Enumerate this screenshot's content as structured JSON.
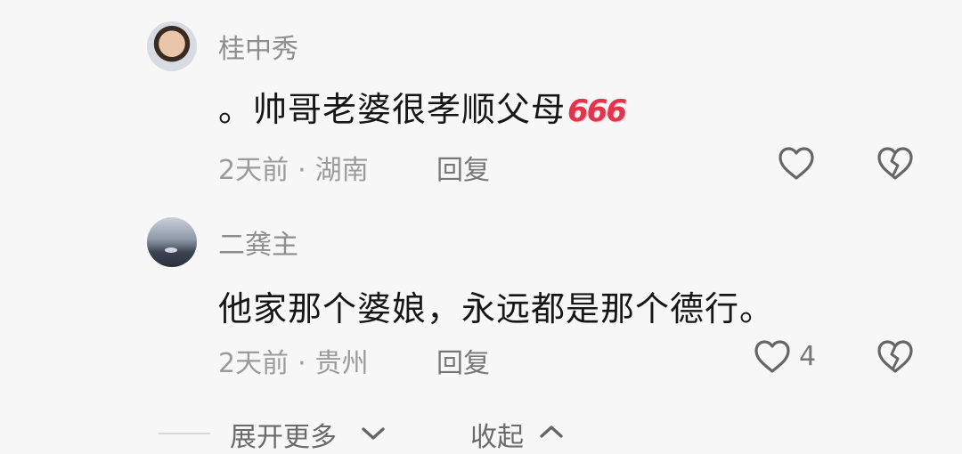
{
  "comments": [
    {
      "author": "桂中秀",
      "text": "。帅哥老婆很孝顺父母",
      "emoji": "666",
      "time": "2天前",
      "location": "湖南",
      "reply_label": "回复",
      "like_count": "",
      "avatar_icon": "user-avatar",
      "like_icon": "heart-outline-icon",
      "dislike_icon": "broken-heart-icon"
    },
    {
      "author": "二龚主",
      "text": "他家那个婆娘，永远都是那个德行。",
      "time": "2天前",
      "location": "贵州",
      "reply_label": "回复",
      "like_count": "4",
      "avatar_icon": "user-avatar",
      "like_icon": "heart-outline-icon",
      "dislike_icon": "broken-heart-icon"
    }
  ],
  "footer": {
    "expand_label": "展开更多",
    "collapse_label": "收起",
    "expand_icon": "chevron-down-icon",
    "collapse_icon": "chevron-up-icon"
  },
  "colors": {
    "background": "#f7f7f7",
    "text_primary": "#161616",
    "text_secondary": "#9b9b9b",
    "emoji_red": "#e3344e"
  }
}
